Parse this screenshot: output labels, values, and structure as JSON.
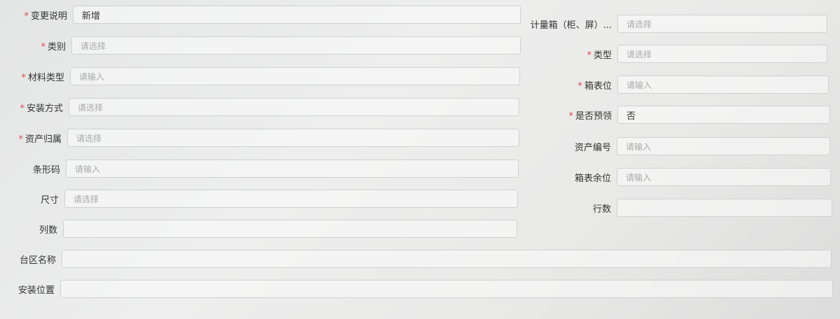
{
  "left": [
    {
      "label": "变更说明",
      "required": true,
      "value": "新增",
      "placeholder": ""
    },
    {
      "label": "类别",
      "required": true,
      "value": "",
      "placeholder": "请选择"
    },
    {
      "label": "材料类型",
      "required": true,
      "value": "",
      "placeholder": "请输入"
    },
    {
      "label": "安装方式",
      "required": true,
      "value": "",
      "placeholder": "请选择"
    },
    {
      "label": "资产归属",
      "required": true,
      "value": "",
      "placeholder": "请选择"
    },
    {
      "label": "条形码",
      "required": false,
      "value": "",
      "placeholder": "请输入"
    },
    {
      "label": "尺寸",
      "required": false,
      "value": "",
      "placeholder": "请选择"
    },
    {
      "label": "列数",
      "required": false,
      "value": "",
      "placeholder": ""
    },
    {
      "label": "台区名称",
      "required": false,
      "value": "",
      "placeholder": ""
    },
    {
      "label": "安装位置",
      "required": false,
      "value": "",
      "placeholder": ""
    }
  ],
  "right": [
    {
      "label": "计量箱（柜、屏）...",
      "required": false,
      "value": "",
      "placeholder": "请选择"
    },
    {
      "label": "类型",
      "required": true,
      "value": "",
      "placeholder": "请选择"
    },
    {
      "label": "箱表位",
      "required": true,
      "value": "",
      "placeholder": "请输入"
    },
    {
      "label": "是否预领",
      "required": true,
      "value": "否",
      "placeholder": ""
    },
    {
      "label": "资产编号",
      "required": false,
      "value": "",
      "placeholder": "请输入"
    },
    {
      "label": "箱表余位",
      "required": false,
      "value": "",
      "placeholder": "请输入"
    },
    {
      "label": "行数",
      "required": false,
      "value": "",
      "placeholder": ""
    }
  ]
}
